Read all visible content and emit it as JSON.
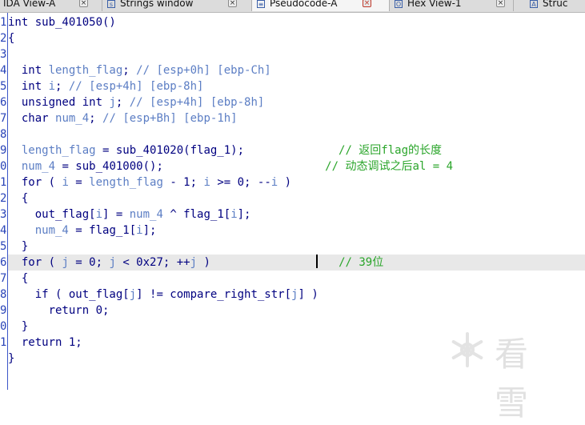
{
  "tabs": [
    {
      "label": "IDA View-A",
      "icon": "ida-view-icon",
      "active": false
    },
    {
      "label": "Strings window",
      "icon": "strings-icon",
      "icon_text": "\"s\"",
      "active": false
    },
    {
      "label": "Pseudocode-A",
      "icon": "pseudocode-icon",
      "active": true
    },
    {
      "label": "Hex View-1",
      "icon": "hex-icon",
      "icon_text": "O",
      "active": false
    },
    {
      "label": "Struc",
      "icon": "structures-icon",
      "icon_text": "A",
      "active": false
    }
  ],
  "close_glyph": "×",
  "editor": {
    "line_numbers": [
      "1",
      "2",
      "3",
      "4",
      "5",
      "6",
      "7",
      "8",
      "9",
      "0",
      "1",
      "2",
      "3",
      "4",
      "5",
      "6",
      "7",
      "8",
      "9",
      "0",
      "1"
    ],
    "lines": [
      [
        [
          "int sub_401050()",
          ""
        ]
      ],
      [
        [
          "{",
          ""
        ]
      ],
      [
        [
          "",
          ""
        ]
      ],
      [
        [
          "  int ",
          ""
        ],
        [
          "length_flag",
          "v"
        ],
        [
          "; ",
          ""
        ],
        [
          "// [esp+0h] [ebp-Ch]",
          "v"
        ]
      ],
      [
        [
          "  int ",
          ""
        ],
        [
          "i",
          "v"
        ],
        [
          "; ",
          ""
        ],
        [
          "// [esp+4h] [ebp-8h]",
          "v"
        ]
      ],
      [
        [
          "  unsigned int ",
          ""
        ],
        [
          "j",
          "v"
        ],
        [
          "; ",
          ""
        ],
        [
          "// [esp+4h] [ebp-8h]",
          "v"
        ]
      ],
      [
        [
          "  char ",
          ""
        ],
        [
          "num_4",
          "v"
        ],
        [
          "; ",
          ""
        ],
        [
          "// [esp+Bh] [ebp-1h]",
          "v"
        ]
      ],
      [
        [
          "",
          ""
        ]
      ],
      [
        [
          "  ",
          ""
        ],
        [
          "length_flag",
          "v"
        ],
        [
          " = sub_401020(flag_1);              ",
          ""
        ],
        [
          "// 返回flag的长度",
          "c"
        ]
      ],
      [
        [
          "  ",
          ""
        ],
        [
          "num_4",
          "v"
        ],
        [
          " = sub_401000();                        ",
          ""
        ],
        [
          "// 动态调试之后al = 4",
          "c"
        ]
      ],
      [
        [
          "  for ( ",
          ""
        ],
        [
          "i",
          "v"
        ],
        [
          " = ",
          ""
        ],
        [
          "length_flag",
          "v"
        ],
        [
          " - 1; ",
          ""
        ],
        [
          "i",
          "v"
        ],
        [
          " >= 0; --",
          ""
        ],
        [
          "i",
          "v"
        ],
        [
          " )",
          ""
        ]
      ],
      [
        [
          "  {",
          ""
        ]
      ],
      [
        [
          "    out_flag[",
          ""
        ],
        [
          "i",
          "v"
        ],
        [
          "] = ",
          ""
        ],
        [
          "num_4",
          "v"
        ],
        [
          " ^ flag_1[",
          ""
        ],
        [
          "i",
          "v"
        ],
        [
          "];",
          ""
        ]
      ],
      [
        [
          "    ",
          ""
        ],
        [
          "num_4",
          "v"
        ],
        [
          " = flag_1[",
          ""
        ],
        [
          "i",
          "v"
        ],
        [
          "];",
          ""
        ]
      ],
      [
        [
          "  }",
          ""
        ]
      ],
      [
        [
          "  for ( ",
          ""
        ],
        [
          "j",
          "v"
        ],
        [
          " = 0; ",
          ""
        ],
        [
          "j",
          "v"
        ],
        [
          " < 0x27; ++",
          ""
        ],
        [
          "j",
          "v"
        ],
        [
          " )                   ",
          ""
        ],
        [
          "// 39位",
          "c"
        ]
      ],
      [
        [
          "  {",
          ""
        ]
      ],
      [
        [
          "    if ( out_flag[",
          ""
        ],
        [
          "j",
          "v"
        ],
        [
          "] != compare_right_str[",
          ""
        ],
        [
          "j",
          "v"
        ],
        [
          "] )",
          ""
        ]
      ],
      [
        [
          "      return 0;",
          ""
        ]
      ],
      [
        [
          "  }",
          ""
        ]
      ],
      [
        [
          "  return 1;",
          ""
        ]
      ],
      [
        [
          "}",
          ""
        ]
      ]
    ],
    "highlighted_line": 15
  },
  "watermark": {
    "text": "看雪",
    "icon": "snowflake-logo-icon"
  }
}
